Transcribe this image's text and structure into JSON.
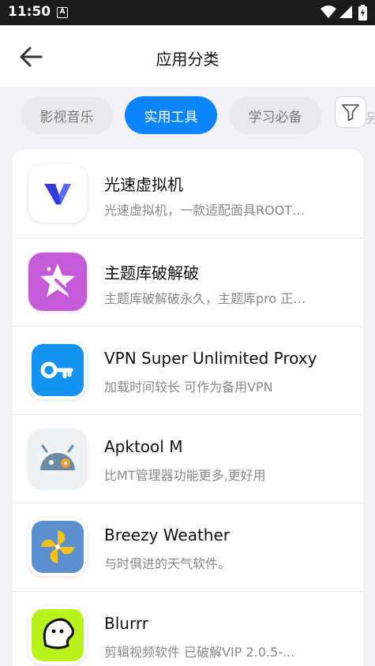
{
  "status": {
    "time": "11:50",
    "notification_letter": "A"
  },
  "header": {
    "title": "应用分类"
  },
  "tabs": [
    {
      "label": "影视音乐",
      "active": false
    },
    {
      "label": "实用工具",
      "active": true
    },
    {
      "label": "学习必备",
      "active": false
    }
  ],
  "tab_peek": "另",
  "apps": [
    {
      "name": "光速虚拟机",
      "desc": "光速虚拟机，一款适配面具ROOT…",
      "icon": "lightspeed-v-icon"
    },
    {
      "name": "主题库破解破",
      "desc": "主题库破解破永久，主题库pro 正…",
      "icon": "theme-star-icon"
    },
    {
      "name": "VPN Super Unlimited Proxy",
      "desc": "加载时间较长 可作为备用VPN",
      "icon": "vpn-key-icon"
    },
    {
      "name": "Apktool M",
      "desc": "比MT管理器功能更多,更好用",
      "icon": "android-gear-icon"
    },
    {
      "name": "Breezy Weather",
      "desc": "与时俱进的天气软件。",
      "icon": "pinwheel-icon"
    },
    {
      "name": "Blurrr",
      "desc": "剪辑视频软件 已破解VIP 2.0.5-...",
      "icon": "blurrr-face-icon"
    }
  ],
  "colors": {
    "accent": "#0a84ff",
    "background": "#f3f3f5"
  }
}
